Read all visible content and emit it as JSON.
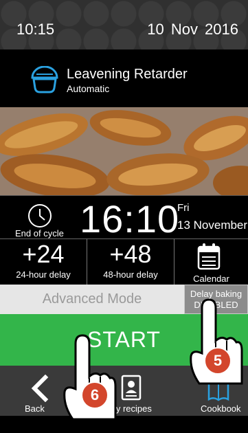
{
  "status": {
    "time": "10:15",
    "date": "10 Nov 2016"
  },
  "program": {
    "name": "Leavening Retarder",
    "mode": "Automatic",
    "icon": "leavening-retarder-icon"
  },
  "cycle": {
    "label": "End of cycle",
    "time": "16:10",
    "day": "Fri",
    "day_date": "13 November"
  },
  "delays": [
    {
      "value": "+24",
      "label": "24-hour delay"
    },
    {
      "value": "+48",
      "label": "48-hour delay"
    }
  ],
  "calendar": {
    "label": "Calendar"
  },
  "advanced": {
    "label": "Advanced Mode"
  },
  "delay_baking": {
    "line1": "Delay baking",
    "line2": "DISABLED"
  },
  "start": {
    "label": "START"
  },
  "nav": {
    "back": "Back",
    "recipes": "My recipes",
    "cookbook": "Cookbook"
  },
  "callouts": {
    "six": "6",
    "five": "5"
  },
  "colors": {
    "start_green": "#33b54a",
    "accent_blue": "#2aa1e0",
    "badge_red": "#d3462c"
  }
}
